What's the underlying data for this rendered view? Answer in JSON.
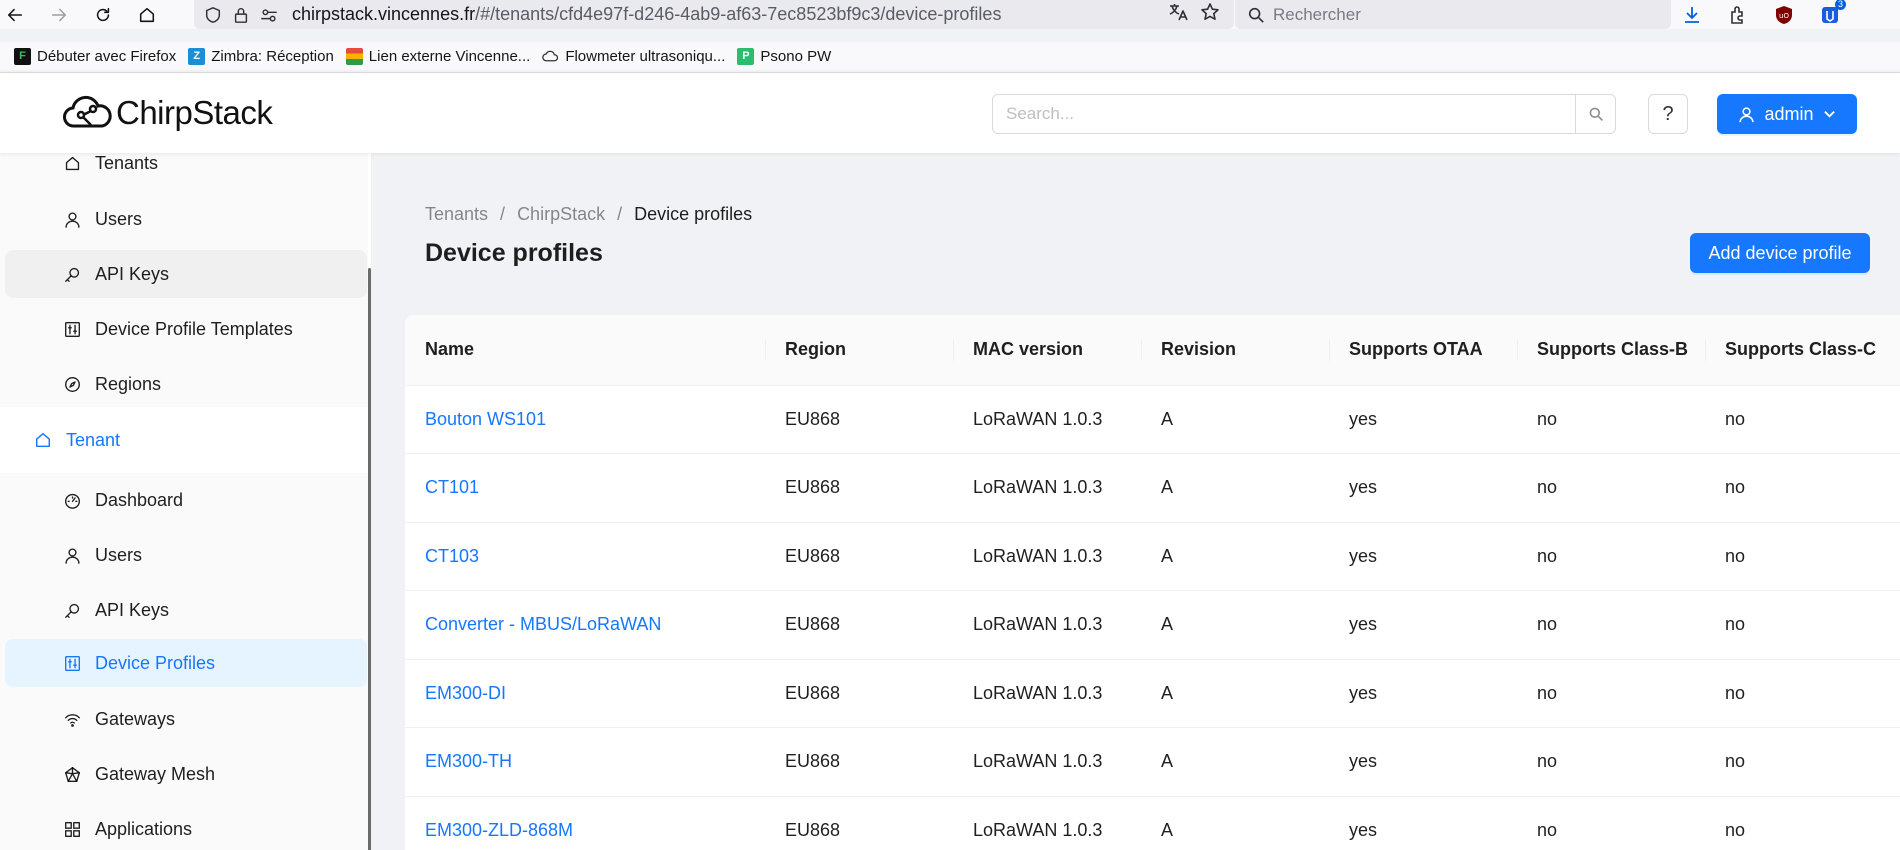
{
  "browser": {
    "url_host": "chirpstack.vincennes.fr",
    "url_path": "/#/tenants/cfd4e97f-d246-4ab9-af63-7ec8523bf9c3/device-profiles",
    "search_placeholder": "Rechercher",
    "extension_badge": "3",
    "bookmarks": [
      {
        "label": "Débuter avec Firefox",
        "icon": "firefox-bookmark-icon"
      },
      {
        "label": "Zimbra: Réception",
        "icon": "zimbra-icon"
      },
      {
        "label": "Lien externe Vincenne...",
        "icon": "layers-icon"
      },
      {
        "label": "Flowmeter ultrasoniqu...",
        "icon": "cloud-link-icon"
      },
      {
        "label": "Psono PW",
        "icon": "psono-icon"
      }
    ]
  },
  "header": {
    "logo_text": "ChirpStack",
    "search_placeholder": "Search...",
    "help_label": "?",
    "user_label": "admin"
  },
  "sidebar": {
    "top_items": [
      {
        "label": "Tenants",
        "icon": "home-icon"
      },
      {
        "label": "Users",
        "icon": "user-icon"
      },
      {
        "label": "API Keys",
        "icon": "key-icon"
      },
      {
        "label": "Device Profile Templates",
        "icon": "sliders-icon"
      },
      {
        "label": "Regions",
        "icon": "compass-icon"
      }
    ],
    "group_title": "Tenant",
    "tenant_items": [
      {
        "label": "Dashboard",
        "icon": "dashboard-icon"
      },
      {
        "label": "Users",
        "icon": "user-icon"
      },
      {
        "label": "API Keys",
        "icon": "key-icon"
      },
      {
        "label": "Device Profiles",
        "icon": "sliders-icon"
      },
      {
        "label": "Gateways",
        "icon": "wifi-icon"
      },
      {
        "label": "Gateway Mesh",
        "icon": "mesh-icon"
      },
      {
        "label": "Applications",
        "icon": "appstore-icon"
      }
    ]
  },
  "main": {
    "breadcrumb": [
      "Tenants",
      "ChirpStack",
      "Device profiles"
    ],
    "breadcrumb_separator": "/",
    "title": "Device profiles",
    "add_button": "Add device profile",
    "columns": [
      "Name",
      "Region",
      "MAC version",
      "Revision",
      "Supports OTAA",
      "Supports Class-B",
      "Supports Class-C"
    ],
    "rows": [
      [
        "Bouton WS101",
        "EU868",
        "LoRaWAN 1.0.3",
        "A",
        "yes",
        "no",
        "no"
      ],
      [
        "CT101",
        "EU868",
        "LoRaWAN 1.0.3",
        "A",
        "yes",
        "no",
        "no"
      ],
      [
        "CT103",
        "EU868",
        "LoRaWAN 1.0.3",
        "A",
        "yes",
        "no",
        "no"
      ],
      [
        "Converter - MBUS/LoRaWAN",
        "EU868",
        "LoRaWAN 1.0.3",
        "A",
        "yes",
        "no",
        "no"
      ],
      [
        "EM300-DI",
        "EU868",
        "LoRaWAN 1.0.3",
        "A",
        "yes",
        "no",
        "no"
      ],
      [
        "EM300-TH",
        "EU868",
        "LoRaWAN 1.0.3",
        "A",
        "yes",
        "no",
        "no"
      ],
      [
        "EM300-ZLD-868M",
        "EU868",
        "LoRaWAN 1.0.3",
        "A",
        "yes",
        "no",
        "no"
      ]
    ]
  },
  "colors": {
    "primary": "#1677ff",
    "selected_bg": "#e6f4ff",
    "page_bg": "#f0f2f5"
  }
}
